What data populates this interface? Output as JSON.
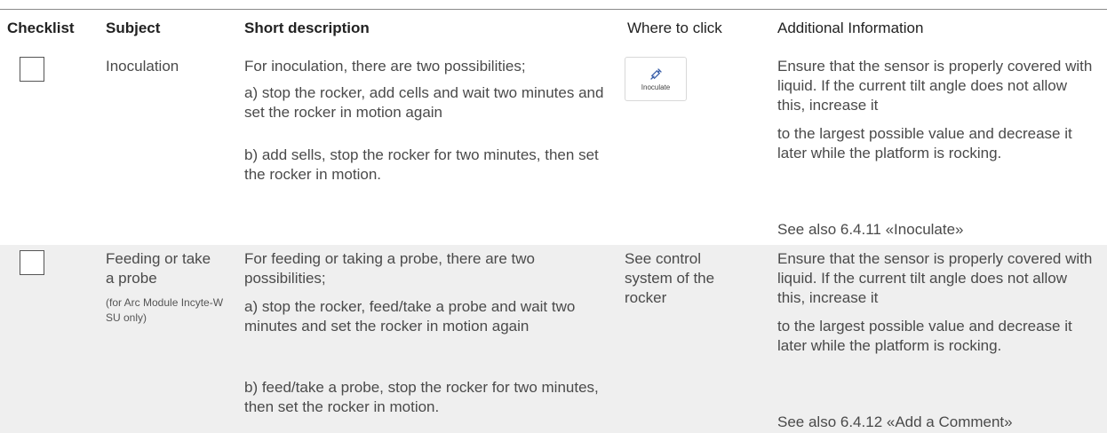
{
  "headers": {
    "checklist": "Checklist",
    "subject": "Subject",
    "short_description": "Short description",
    "where_to_click": "Where to click",
    "additional_information": "Additional Information"
  },
  "rows": [
    {
      "subject": "Inoculation",
      "description": [
        "For inoculation, there are two possibilities;",
        "a) stop the rocker, add cells and wait two minutes and set the rocker in motion again",
        "b) add sells, stop the rocker for two minutes, then set the rocker in motion."
      ],
      "where_button": {
        "label": "Inoculate",
        "icon": "syringe-icon"
      },
      "info": [
        "Ensure that the sensor is properly covered with liquid. If the current tilt angle does not allow this, increase it",
        "to the largest possible value and decrease it later while the platform is rocking.",
        "See also 6.4.11 «Inoculate»"
      ]
    },
    {
      "subject": "Feeding or take a probe",
      "subject_note": "(for Arc Module Incyte-W SU only)",
      "description": [
        "For feeding or taking a probe, there are two possibilities;",
        "a) stop the rocker, feed/take a probe and wait two minutes and set the rocker in motion again",
        "b) feed/take a probe, stop the rocker for two minutes, then set the rocker in motion."
      ],
      "where_text": "See control system of the rocker",
      "info": [
        "Ensure that the sensor is properly covered with liquid. If the current tilt angle does not allow this, increase it",
        "to the largest possible value and decrease it later while the platform is rocking.",
        "See also 6.4.12 «Add a Comment»"
      ]
    }
  ],
  "colors": {
    "row_alt_bg": "#efefef",
    "rule": "#8a8a8a"
  }
}
